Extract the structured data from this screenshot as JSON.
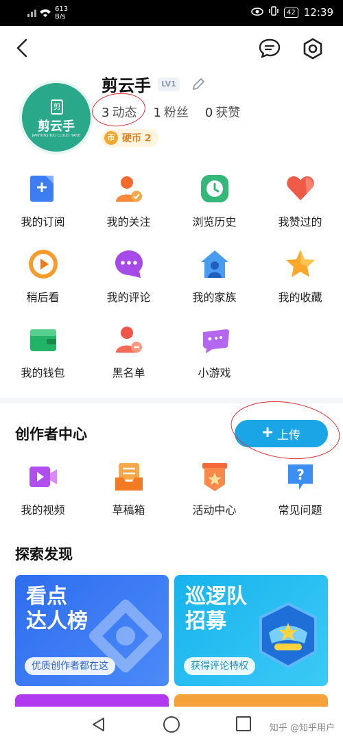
{
  "status_bar": {
    "net_speed": "613",
    "net_unit": "B/s",
    "battery": "42",
    "time": "12:39"
  },
  "profile": {
    "avatar_badge": "剪",
    "avatar_name": "剪云手",
    "avatar_sub": "JIANYUNSHOU CLOUD HAND",
    "username": "剪云手",
    "level": "LV1",
    "stats": [
      {
        "count": "3",
        "label": "动态"
      },
      {
        "count": "1",
        "label": "粉丝"
      },
      {
        "count": "0",
        "label": "获赞"
      }
    ],
    "coin_icon": "币",
    "coin_label": "硬币 2"
  },
  "menu": [
    {
      "label": "我的订阅",
      "icon": "subscription-icon"
    },
    {
      "label": "我的关注",
      "icon": "following-icon"
    },
    {
      "label": "浏览历史",
      "icon": "history-icon"
    },
    {
      "label": "我赞过的",
      "icon": "liked-icon"
    },
    {
      "label": "稍后看",
      "icon": "watch-later-icon"
    },
    {
      "label": "我的评论",
      "icon": "comments-icon"
    },
    {
      "label": "我的家族",
      "icon": "family-icon"
    },
    {
      "label": "我的收藏",
      "icon": "favorites-icon"
    },
    {
      "label": "我的钱包",
      "icon": "wallet-icon"
    },
    {
      "label": "黑名单",
      "icon": "blacklist-icon"
    },
    {
      "label": "小游戏",
      "icon": "game-icon"
    }
  ],
  "creator": {
    "title": "创作者中心",
    "upload_label": "上传",
    "items": [
      {
        "label": "我的视频",
        "icon": "video-icon"
      },
      {
        "label": "草稿箱",
        "icon": "drafts-icon"
      },
      {
        "label": "活动中心",
        "icon": "activity-icon"
      },
      {
        "label": "常见问题",
        "icon": "faq-icon"
      }
    ]
  },
  "explore": {
    "title": "探索发现",
    "cards": [
      {
        "line1": "看点",
        "line2": "达人榜",
        "pill": "优质创作者都在这"
      },
      {
        "line1": "巡逻队",
        "line2": "招募",
        "pill": "获得评论特权"
      }
    ]
  },
  "watermark": "知乎 @知乎用户"
}
